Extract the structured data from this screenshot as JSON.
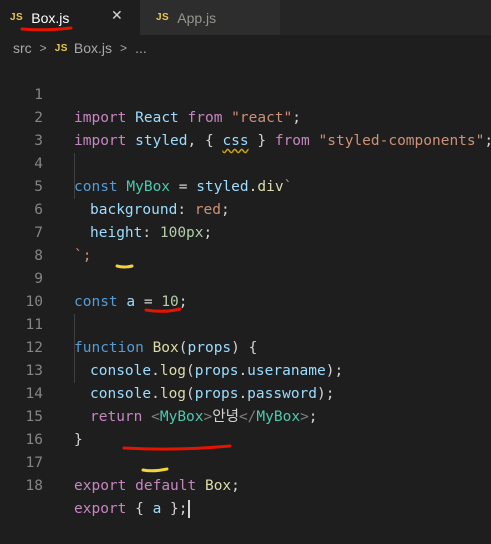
{
  "tabs": [
    {
      "badge": "JS",
      "label": "Box.js",
      "close": "✕",
      "active": true
    },
    {
      "badge": "JS",
      "label": "App.js",
      "active": false
    }
  ],
  "breadcrumb": {
    "folder": "src",
    "badge": "JS",
    "file": "Box.js",
    "more": "..."
  },
  "lines": [
    {
      "n": "1"
    },
    {
      "n": "2"
    },
    {
      "n": "3"
    },
    {
      "n": "4"
    },
    {
      "n": "5"
    },
    {
      "n": "6"
    },
    {
      "n": "7"
    },
    {
      "n": "8"
    },
    {
      "n": "9"
    },
    {
      "n": "10"
    },
    {
      "n": "11"
    },
    {
      "n": "12"
    },
    {
      "n": "13"
    },
    {
      "n": "14"
    },
    {
      "n": "15"
    },
    {
      "n": "16"
    },
    {
      "n": "17"
    },
    {
      "n": "18"
    }
  ],
  "code": {
    "l1": {
      "import": "import",
      "react": "React",
      "from": "from",
      "str": "\"react\"",
      "semi": ";"
    },
    "l2": {
      "import": "import",
      "styled": "styled",
      "open": ", { ",
      "css": "css",
      "close": " } ",
      "from": "from",
      "str": "\"styled-components\"",
      "semi": ";"
    },
    "l4": {
      "const": "const",
      "name": "MyBox",
      "eq": " = ",
      "obj": "styled",
      "prop": ".div",
      "tick": "`"
    },
    "l5": {
      "prop": "background",
      "colon": ": ",
      "val": "red",
      "semi": ";"
    },
    "l6": {
      "prop": "height",
      "colon": ": ",
      "val": "100px",
      "semi": ";"
    },
    "l7": {
      "text": "`;"
    },
    "l9": {
      "const": "const",
      "name": "a",
      "eq": " = ",
      "num": "10",
      "semi": ";"
    },
    "l11": {
      "function": "function",
      "name": "Box",
      "open": "(",
      "param": "props",
      "close": ") {"
    },
    "l12": {
      "obj": "console",
      "dot1": ".",
      "fn": "log",
      "open": "(",
      "arg": "props",
      "dot2": ".",
      "field": "useraname",
      "close": ");"
    },
    "l13": {
      "obj": "console",
      "dot1": ".",
      "fn": "log",
      "open": "(",
      "arg": "props",
      "dot2": ".",
      "field": "password",
      "close": ");"
    },
    "l14": {
      "ret": "return",
      "lt": " <",
      "tag": "MyBox",
      "gt": ">",
      "text": "안녕",
      "lt2": "</",
      "tag2": "MyBox",
      "gt2": ">",
      "semi": ";"
    },
    "l15": {
      "text": "}"
    },
    "l17": {
      "export": "export",
      "default": "default",
      "name": "Box",
      "semi": ";"
    },
    "l18": {
      "export": "export",
      "open": " { ",
      "name": "a",
      "close": " };"
    }
  },
  "colors": {
    "annotation_red": "#e51400",
    "annotation_yellow": "#f3d33b",
    "editor_bg": "#1e1e1e"
  }
}
